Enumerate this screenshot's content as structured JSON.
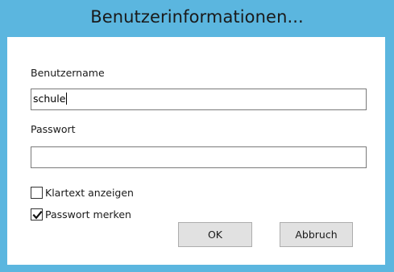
{
  "window": {
    "title": "Benutzerinformationen..."
  },
  "form": {
    "username_label": "Benutzername",
    "username_value": "schule",
    "password_label": "Passwort",
    "password_value": "",
    "show_plaintext_label": "Klartext anzeigen",
    "show_plaintext_checked": false,
    "remember_password_label": "Passwort merken",
    "remember_password_checked": true
  },
  "buttons": {
    "ok_label": "OK",
    "cancel_label": "Abbruch"
  },
  "colors": {
    "frame": "#5bb6df",
    "button_face": "#e1e1e1",
    "button_border": "#adadad"
  },
  "icons": {
    "checkmark": "checkmark-icon"
  }
}
